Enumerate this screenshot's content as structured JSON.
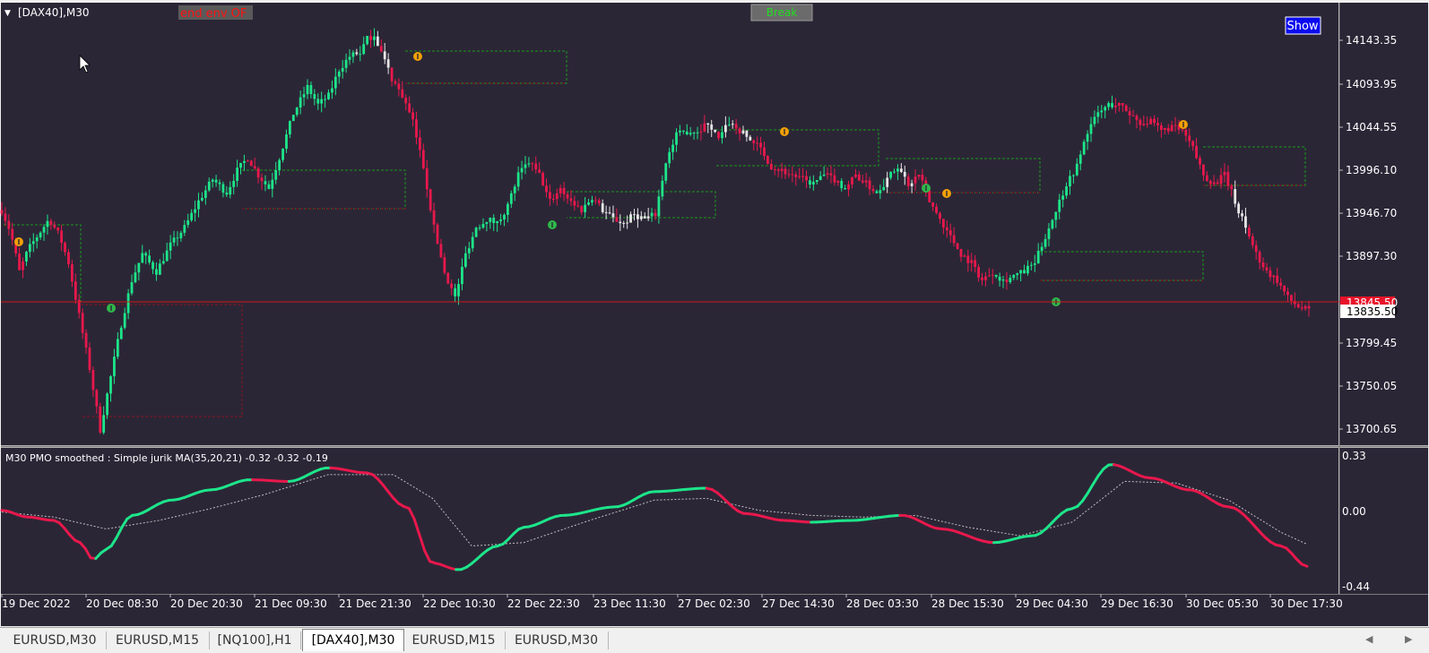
{
  "window": {
    "title": "[DAX40],M30",
    "label_end_env": "end env OF",
    "break_button": "Break",
    "show_button": "Show"
  },
  "colors": {
    "background": "#2b2636",
    "bull": "#1de58a",
    "bear": "#e8184c",
    "doji": "#e6e6e6",
    "line_price": "#d11717",
    "marker_orange": "#f2a007",
    "marker_green": "#2fb94a",
    "level_green": "#1a9a1a",
    "level_red": "#8a1422"
  },
  "price_axis": {
    "labels": [
      "14143.35",
      "14093.95",
      "14044.55",
      "13996.10",
      "13946.70",
      "13897.30",
      "13799.45",
      "13750.05",
      "13700.65"
    ],
    "current_price": "13835.50",
    "current_price_hidden": "13845.50"
  },
  "indicator": {
    "label": "M30 PMO smoothed : Simple jurik MA(35,20,21) -0.32 -0.32 -0.19",
    "axis_labels": [
      "0.33",
      "0.00",
      "-0.44"
    ]
  },
  "time_axis": {
    "labels": [
      "19 Dec 2022",
      "20 Dec 08:30",
      "20 Dec 20:30",
      "21 Dec 09:30",
      "21 Dec 21:30",
      "22 Dec 10:30",
      "22 Dec 22:30",
      "23 Dec 11:30",
      "27 Dec 02:30",
      "27 Dec 14:30",
      "28 Dec 03:30",
      "28 Dec 15:30",
      "29 Dec 04:30",
      "29 Dec 16:30",
      "30 Dec 05:30",
      "30 Dec 17:30"
    ]
  },
  "tabs": [
    {
      "label": "EURUSD,M30",
      "active": false
    },
    {
      "label": "EURUSD,M15",
      "active": false
    },
    {
      "label": "[NQ100],H1",
      "active": false
    },
    {
      "label": "[DAX40],M30",
      "active": true
    },
    {
      "label": "EURUSD,M15",
      "active": false
    },
    {
      "label": "EURUSD,M30",
      "active": false
    }
  ],
  "chart_data": {
    "type": "candlestick",
    "symbol": "[DAX40]",
    "timeframe": "M30",
    "price_range": [
      13690,
      14170
    ],
    "current_price": 13835.5,
    "horizontal_line": 13845.5,
    "price_path": [
      [
        0,
        13950
      ],
      [
        5,
        13925
      ],
      [
        10,
        13880
      ],
      [
        15,
        13905
      ],
      [
        20,
        13920
      ],
      [
        27,
        13940
      ],
      [
        33,
        13920
      ],
      [
        38,
        13890
      ],
      [
        44,
        13830
      ],
      [
        50,
        13770
      ],
      [
        56,
        13700
      ],
      [
        62,
        13760
      ],
      [
        68,
        13820
      ],
      [
        74,
        13870
      ],
      [
        80,
        13900
      ],
      [
        88,
        13880
      ],
      [
        96,
        13910
      ],
      [
        104,
        13930
      ],
      [
        112,
        13960
      ],
      [
        120,
        13985
      ],
      [
        128,
        13970
      ],
      [
        134,
        13995
      ],
      [
        140,
        14010
      ],
      [
        146,
        13990
      ],
      [
        152,
        13975
      ],
      [
        158,
        14010
      ],
      [
        166,
        14060
      ],
      [
        174,
        14090
      ],
      [
        180,
        14070
      ],
      [
        186,
        14080
      ],
      [
        192,
        14110
      ],
      [
        198,
        14125
      ],
      [
        204,
        14130
      ],
      [
        208,
        14145
      ],
      [
        212,
        14150
      ],
      [
        216,
        14130
      ],
      [
        222,
        14100
      ],
      [
        228,
        14080
      ],
      [
        234,
        14050
      ],
      [
        240,
        14000
      ],
      [
        246,
        13930
      ],
      [
        252,
        13880
      ],
      [
        258,
        13850
      ],
      [
        264,
        13900
      ],
      [
        270,
        13930
      ],
      [
        276,
        13940
      ],
      [
        282,
        13935
      ],
      [
        288,
        13955
      ],
      [
        294,
        13990
      ],
      [
        300,
        14005
      ],
      [
        306,
        13990
      ],
      [
        312,
        13960
      ],
      [
        318,
        13975
      ],
      [
        324,
        13960
      ],
      [
        330,
        13950
      ],
      [
        336,
        13965
      ],
      [
        342,
        13950
      ],
      [
        348,
        13940
      ],
      [
        354,
        13935
      ],
      [
        360,
        13945
      ],
      [
        366,
        13940
      ],
      [
        372,
        13945
      ],
      [
        378,
        14005
      ],
      [
        384,
        14035
      ],
      [
        390,
        14040
      ],
      [
        396,
        14040
      ],
      [
        402,
        14050
      ],
      [
        408,
        14030
      ],
      [
        414,
        14050
      ],
      [
        420,
        14040
      ],
      [
        426,
        14030
      ],
      [
        432,
        14020
      ],
      [
        438,
        14000
      ],
      [
        444,
        13995
      ],
      [
        450,
        13990
      ],
      [
        456,
        13985
      ],
      [
        462,
        13980
      ],
      [
        468,
        13990
      ],
      [
        474,
        13985
      ],
      [
        480,
        13975
      ],
      [
        486,
        13990
      ],
      [
        492,
        13980
      ],
      [
        498,
        13970
      ],
      [
        504,
        13985
      ],
      [
        510,
        14000
      ],
      [
        516,
        13980
      ],
      [
        522,
        13990
      ],
      [
        528,
        13960
      ],
      [
        534,
        13940
      ],
      [
        540,
        13920
      ],
      [
        546,
        13900
      ],
      [
        552,
        13890
      ],
      [
        558,
        13870
      ],
      [
        564,
        13880
      ],
      [
        570,
        13870
      ],
      [
        576,
        13875
      ],
      [
        582,
        13880
      ],
      [
        588,
        13890
      ],
      [
        594,
        13920
      ],
      [
        600,
        13950
      ],
      [
        606,
        13980
      ],
      [
        612,
        14000
      ],
      [
        618,
        14040
      ],
      [
        624,
        14060
      ],
      [
        630,
        14070
      ],
      [
        636,
        14070
      ],
      [
        642,
        14060
      ],
      [
        648,
        14050
      ],
      [
        654,
        14050
      ],
      [
        660,
        14040
      ],
      [
        666,
        14045
      ],
      [
        672,
        14040
      ],
      [
        678,
        14020
      ],
      [
        684,
        13990
      ],
      [
        690,
        13980
      ],
      [
        696,
        13990
      ],
      [
        702,
        13960
      ],
      [
        708,
        13930
      ],
      [
        714,
        13900
      ],
      [
        720,
        13880
      ],
      [
        726,
        13870
      ],
      [
        732,
        13850
      ],
      [
        738,
        13840
      ],
      [
        744,
        13835
      ]
    ],
    "pmo_fast": [
      [
        0,
        0.01
      ],
      [
        20,
        -0.03
      ],
      [
        40,
        -0.05
      ],
      [
        60,
        -0.18
      ],
      [
        70,
        -0.28
      ],
      [
        80,
        -0.22
      ],
      [
        100,
        -0.02
      ],
      [
        130,
        0.07
      ],
      [
        160,
        0.13
      ],
      [
        190,
        0.19
      ],
      [
        220,
        0.18
      ],
      [
        250,
        0.26
      ],
      [
        280,
        0.23
      ],
      [
        310,
        0.03
      ],
      [
        330,
        -0.3
      ],
      [
        350,
        -0.34
      ],
      [
        380,
        -0.2
      ],
      [
        400,
        -0.09
      ],
      [
        430,
        -0.02
      ],
      [
        470,
        0.03
      ],
      [
        500,
        0.12
      ],
      [
        540,
        0.14
      ],
      [
        570,
        -0.01
      ],
      [
        600,
        -0.05
      ],
      [
        620,
        -0.06
      ],
      [
        650,
        -0.05
      ],
      [
        690,
        -0.02
      ],
      [
        720,
        -0.1
      ],
      [
        760,
        -0.18
      ],
      [
        790,
        -0.14
      ],
      [
        820,
        0.02
      ],
      [
        850,
        0.28
      ],
      [
        880,
        0.2
      ],
      [
        910,
        0.13
      ],
      [
        940,
        0.03
      ],
      [
        980,
        -0.2
      ],
      [
        1000,
        -0.32
      ]
    ],
    "pmo_slow": [
      [
        0,
        0.0
      ],
      [
        40,
        -0.03
      ],
      [
        80,
        -0.1
      ],
      [
        120,
        -0.05
      ],
      [
        160,
        0.02
      ],
      [
        200,
        0.1
      ],
      [
        250,
        0.22
      ],
      [
        300,
        0.22
      ],
      [
        330,
        0.08
      ],
      [
        360,
        -0.2
      ],
      [
        400,
        -0.18
      ],
      [
        450,
        -0.05
      ],
      [
        500,
        0.07
      ],
      [
        540,
        0.08
      ],
      [
        580,
        0.01
      ],
      [
        620,
        -0.02
      ],
      [
        660,
        -0.03
      ],
      [
        700,
        -0.02
      ],
      [
        740,
        -0.09
      ],
      [
        780,
        -0.14
      ],
      [
        820,
        -0.06
      ],
      [
        860,
        0.18
      ],
      [
        900,
        0.17
      ],
      [
        940,
        0.07
      ],
      [
        980,
        -0.12
      ],
      [
        1000,
        -0.19
      ]
    ]
  }
}
